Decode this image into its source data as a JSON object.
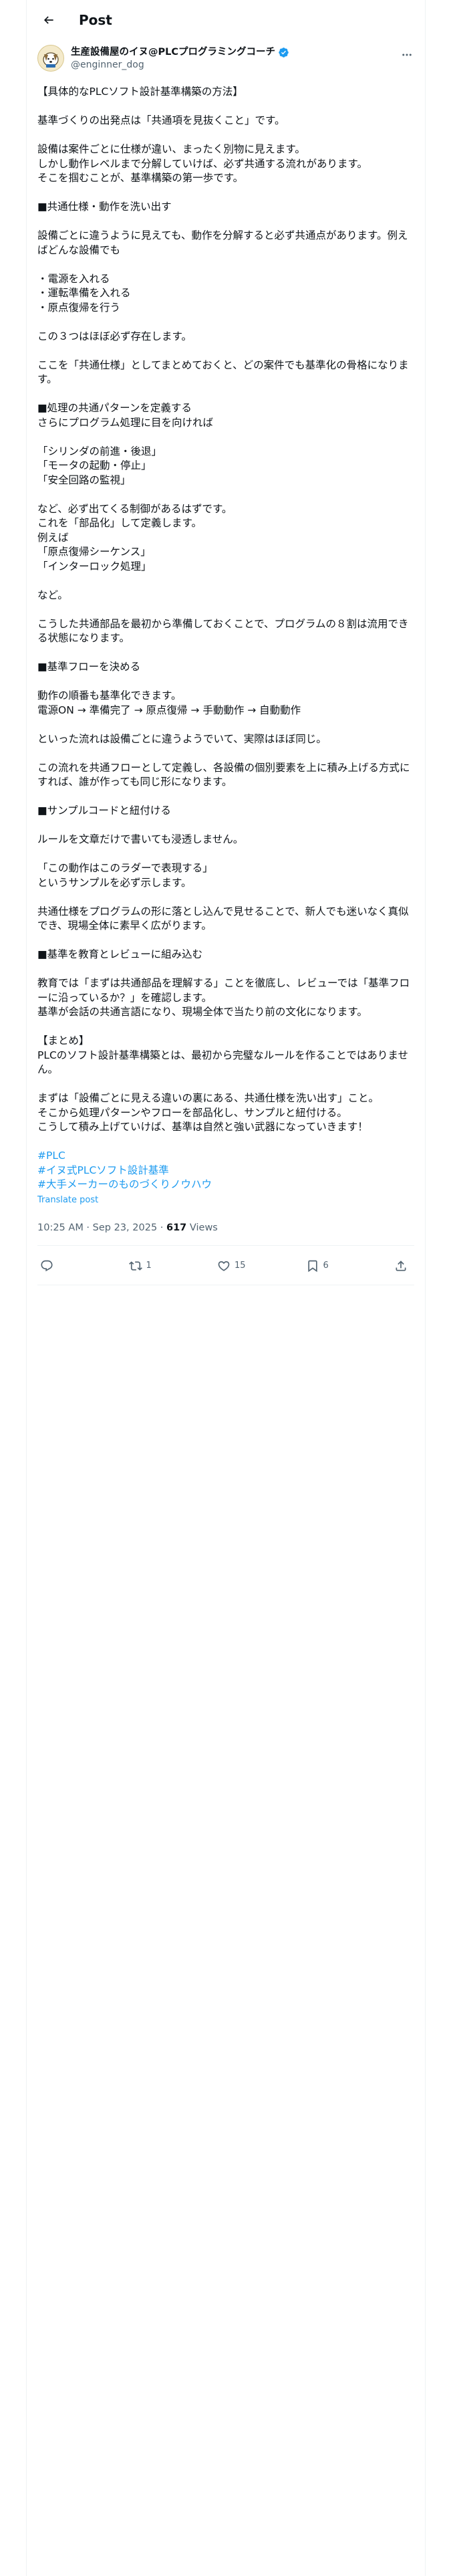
{
  "header": {
    "title": "Post"
  },
  "author": {
    "display_name": "生産設備屋のイヌ@PLCプログラミングコーチ",
    "handle": "@enginner_dog",
    "avatar_icon": "dog-avatar-icon",
    "verified": true
  },
  "post": {
    "paragraphs": [
      "【具体的なPLCソフト設計基準構築の方法】",
      "基準づくりの出発点は「共通項を見抜くこと」です。",
      "設備は案件ごとに仕様が違い、まったく別物に見えます。\nしかし動作レベルまで分解していけば、必ず共通する流れがあります。\nそこを掴むことが、基準構築の第一歩です。",
      "■共通仕様・動作を洗い出す",
      "設備ごとに違うように見えても、動作を分解すると必ず共通点があります。例えばどんな設備でも",
      "・電源を入れる\n・運転準備を入れる\n・原点復帰を行う",
      "この３つはほぼ必ず存在します。",
      "ここを「共通仕様」としてまとめておくと、どの案件でも基準化の骨格になります。",
      "■処理の共通パターンを定義する\nさらにプログラム処理に目を向ければ",
      "「シリンダの前進・後退」\n「モータの起動・停止」\n「安全回路の監視」",
      "など、必ず出てくる制御があるはずです。\nこれを「部品化」して定義します。\n例えば\n「原点復帰シーケンス」\n「インターロック処理」",
      "など。",
      "こうした共通部品を最初から準備しておくことで、プログラムの８割は流用できる状態になります。",
      "■基準フローを決める",
      "動作の順番も基準化できます。\n電源ON → 準備完了 → 原点復帰 → 手動動作 → 自動動作",
      "といった流れは設備ごとに違うようでいて、実際はほぼ同じ。",
      "この流れを共通フローとして定義し、各設備の個別要素を上に積み上げる方式にすれば、誰が作っても同じ形になります。",
      "■サンプルコードと紐付ける",
      "ルールを文章だけで書いても浸透しません。",
      "「この動作はこのラダーで表現する」\nというサンプルを必ず示します。",
      "共通仕様をプログラムの形に落とし込んで見せることで、新人でも迷いなく真似でき、現場全体に素早く広がります。",
      "■基準を教育とレビューに組み込む",
      "教育では「まずは共通部品を理解する」ことを徹底し、レビューでは「基準フローに沿っているか？」を確認します。\n基準が会話の共通言語になり、現場全体で当たり前の文化になります。",
      "【まとめ】\nPLCのソフト設計基準構築とは、最初から完璧なルールを作ることではありません。",
      "まずは「設備ごとに見える違いの裏にある、共通仕様を洗い出す」こと。\nそこから処理パターンやフローを部品化し、サンプルと紐付ける。\nこうして積み上げていけば、基準は自然と強い武器になっていきます！"
    ],
    "hashtags": [
      "#PLC",
      "#イヌ式PLCソフト設計基準",
      "#大手メーカーのものづくりノウハウ"
    ],
    "translate_label": "Translate post",
    "time": "10:25 AM",
    "separator": " · ",
    "date": "Sep 23, 2025",
    "views_count": "617",
    "views_label": " Views"
  },
  "actions": {
    "reply": {
      "icon": "reply-icon",
      "count": ""
    },
    "repost": {
      "icon": "repost-icon",
      "count": "1"
    },
    "like": {
      "icon": "heart-icon",
      "count": "15"
    },
    "bookmark": {
      "icon": "bookmark-icon",
      "count": "6"
    },
    "share": {
      "icon": "share-icon"
    }
  },
  "colors": {
    "accent": "#1d9bf0",
    "text": "#0f1419",
    "secondary": "#536471",
    "border": "#eff3f4"
  }
}
